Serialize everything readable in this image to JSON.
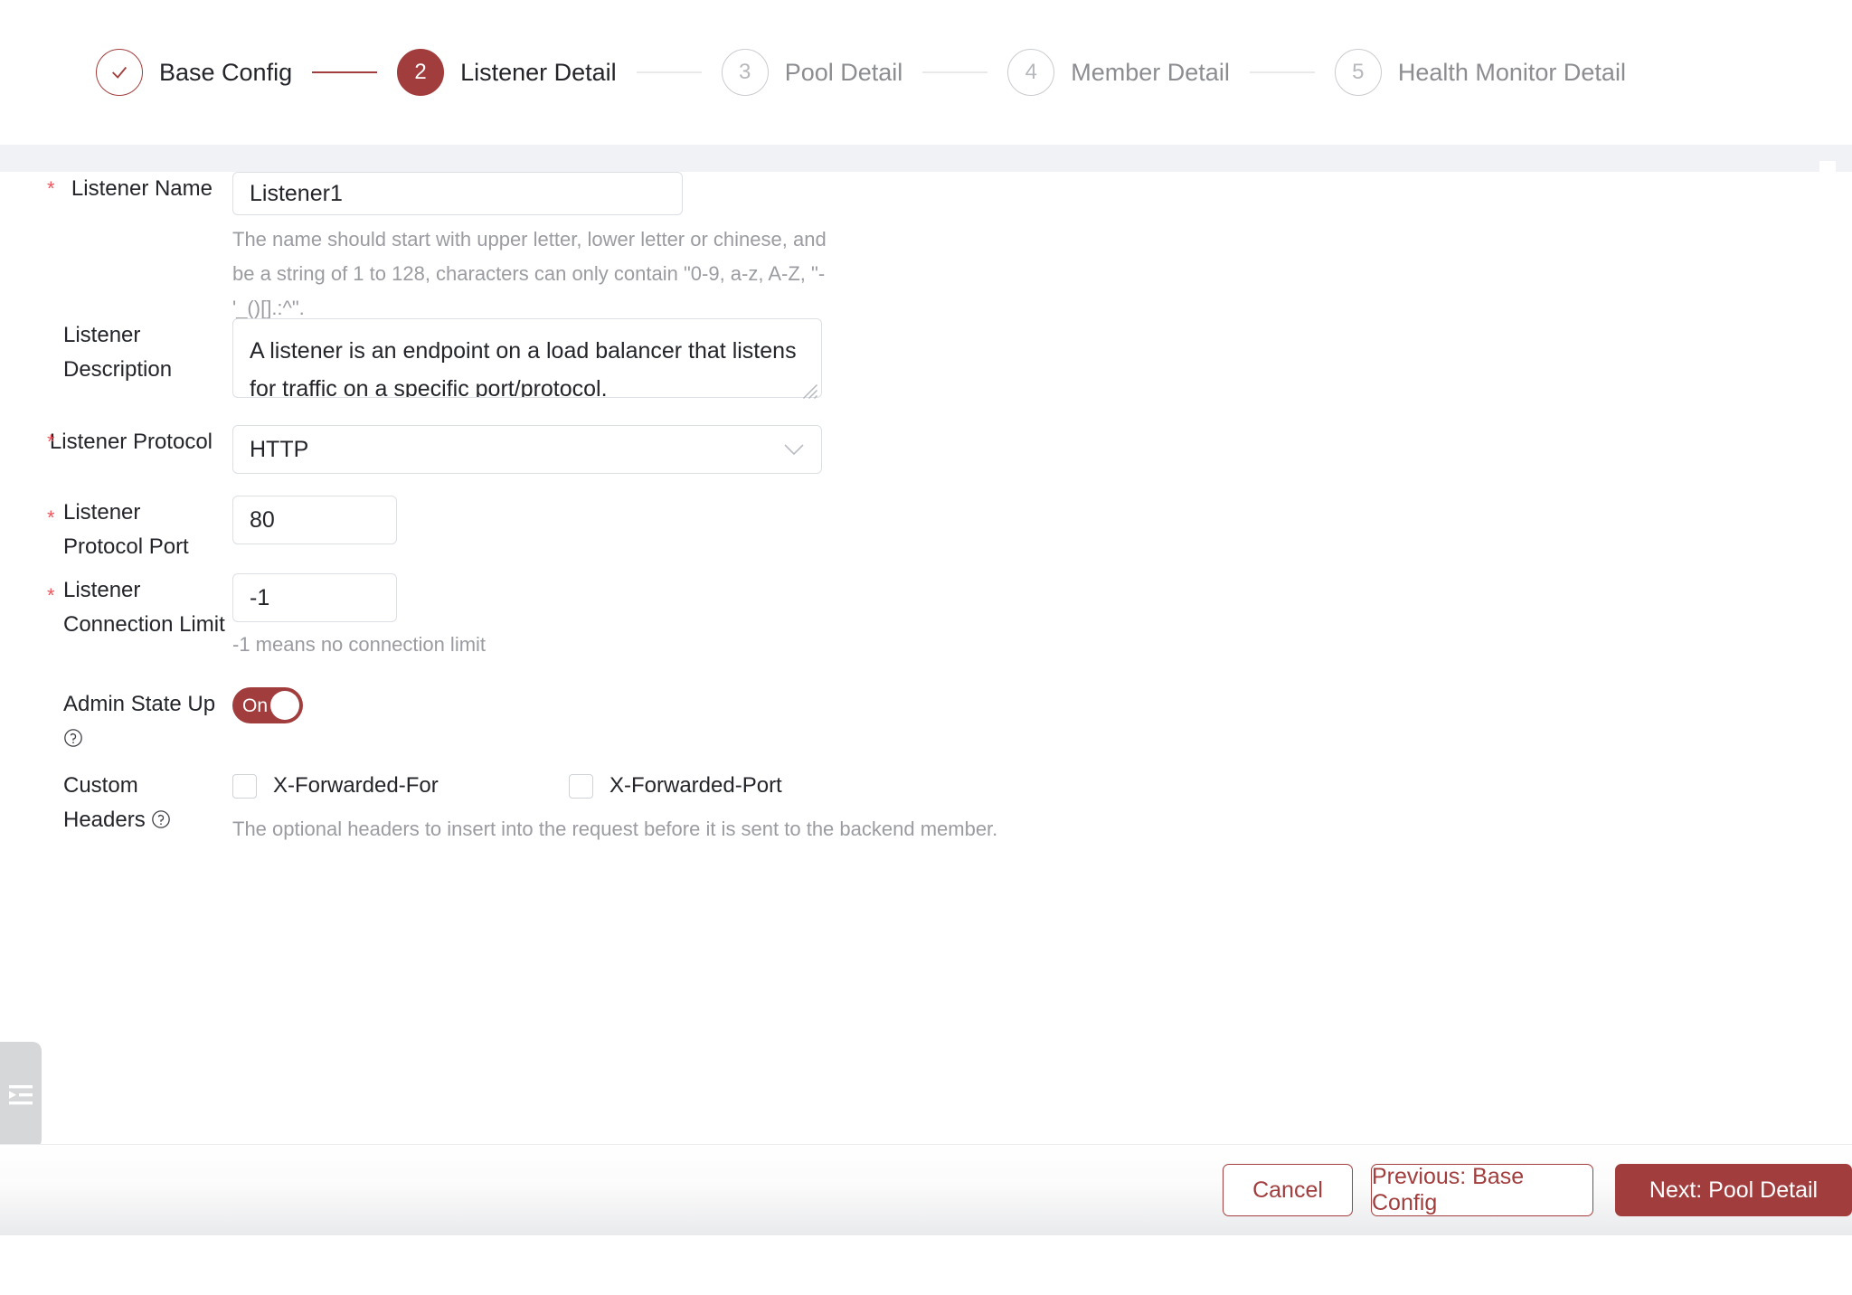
{
  "stepper": {
    "steps": [
      {
        "index": "✓",
        "label": "Base Config",
        "state": "done"
      },
      {
        "index": "2",
        "label": "Listener Detail",
        "state": "active"
      },
      {
        "index": "3",
        "label": "Pool Detail",
        "state": "upcoming"
      },
      {
        "index": "4",
        "label": "Member Detail",
        "state": "upcoming"
      },
      {
        "index": "5",
        "label": "Health Monitor Detail",
        "state": "upcoming"
      }
    ]
  },
  "form": {
    "listener_name": {
      "label": "Listener Name",
      "required_marker": "*",
      "value": "Listener1",
      "placeholder": "",
      "helper": "The name should start with upper letter, lower letter or chinese, and be a string of 1 to 128, characters can only contain \"0-9, a-z, A-Z, \"-'_()[].:^\"."
    },
    "listener_description": {
      "label_line1": "Listener",
      "label_line2": "Description",
      "value": "A listener is an endpoint on a load balancer that listens for traffic on a specific port/protocol.",
      "placeholder": ""
    },
    "listener_protocol": {
      "label": "Listener Protocol",
      "required_marker": "*",
      "value": "HTTP",
      "icon": "chevron-down-icon"
    },
    "listener_protocol_port": {
      "label_line1": "Listener",
      "label_line2": "Protocol Port",
      "required_marker": "*",
      "value": "80",
      "placeholder": ""
    },
    "listener_connection_limit": {
      "label_line1": "Listener",
      "label_line2": "Connection Limit",
      "required_marker": "*",
      "value": "-1",
      "placeholder": "",
      "helper": "-1 means no connection limit"
    },
    "admin_state_up": {
      "label": "Admin State Up",
      "help_icon": "question-circle-icon",
      "toggle_text": "On",
      "toggle_on": true
    },
    "custom_headers": {
      "label_line1": "Custom",
      "label_line2": "Headers",
      "help_icon": "question-circle-icon",
      "options": [
        {
          "label": "X-Forwarded-For",
          "checked": false
        },
        {
          "label": "X-Forwarded-Port",
          "checked": false
        }
      ],
      "helper": "The optional headers to insert into the request before it is sent to the backend member."
    }
  },
  "footer": {
    "cancel_label": "Cancel",
    "previous_label": "Previous: Base Config",
    "next_label": "Next: Pool Detail"
  },
  "sidebar": {
    "collapse_icon": "collapse-left-icon"
  },
  "colors": {
    "accent": "#a23d3d",
    "required_star": "#f5545c",
    "band": "#f0f2f5",
    "border": "#dcdfe4",
    "helper_text": "#9a9ca1",
    "text": "#23252a",
    "step_inactive": "#8b8d91"
  }
}
